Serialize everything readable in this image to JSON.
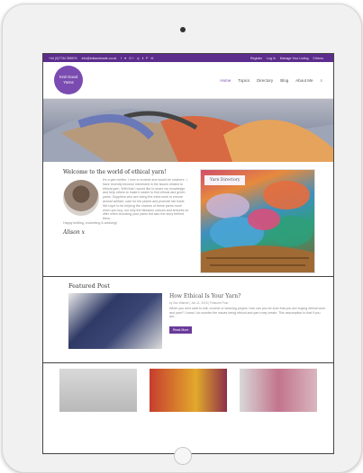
{
  "topbar": {
    "phone": "+44 (0)7734 355974",
    "email": "info@knitandmade.co.uk",
    "social": "f ♥ G+ ◎ 𝐭 P ✉",
    "register": "Register",
    "login": "Log In",
    "manage": "Manage Your Listing",
    "cart": "0 Items"
  },
  "header": {
    "logo": "Knit Good Yarns",
    "nav": [
      "Home",
      "Topics",
      "Directory",
      "Blog",
      "About Me"
    ]
  },
  "welcome": {
    "title": "Welcome to the world of ethical yarn!",
    "text": "It's a yarn knitter, I love to crochet and would be nowhere. I have recently become interested in the issues related to ethical yarn. With that I would like to share my knowledge and help others to make it easier to find ethical and green yarns. Suppliers who are doing the extra work to ensure animal welfare, care for the planet and promote fair trade. We hope to be helping the choices of these yarns more when you buy, not only the fabulous colours and textures on offer when choosing your yarns but also the story behind them.",
    "closing": "Happy knitting, crocheting & weaving!",
    "signature": "Alison x"
  },
  "directory": {
    "label": "Yarn Directory"
  },
  "featured": {
    "title": "Featured Post",
    "post_title": "How Ethical Is Your Yarn?",
    "meta": "by Sue Walmer | Jan 11, 2018 | Featured Post",
    "excerpt": "When you next start to knit, crochet or weaving project, how can you be sure that you are buying ethical wool and yarn? I know I do wonder the issues being ethical and yarn may create. This assumption is that if you are...",
    "button": "Read More"
  }
}
